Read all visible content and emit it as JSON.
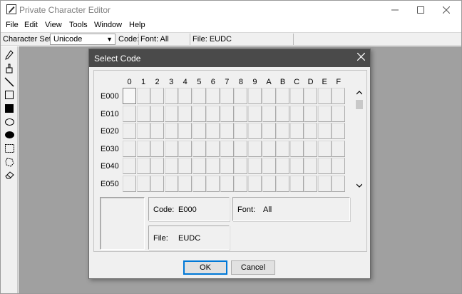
{
  "window": {
    "title": "Private Character Editor"
  },
  "menu": [
    "File",
    "Edit",
    "View",
    "Tools",
    "Window",
    "Help"
  ],
  "toolbar": {
    "charset_label": "Character Set:",
    "charset_value": "Unicode",
    "code_label": "Code:",
    "font_label": "Font: All",
    "file_label": "File: EUDC"
  },
  "tools": [
    "pencil-icon",
    "brush-icon",
    "line-icon",
    "hollow-rectangle-icon",
    "filled-rectangle-icon",
    "hollow-ellipse-icon",
    "filled-ellipse-icon",
    "rectangular-selection-icon",
    "freeform-selection-icon",
    "eraser-icon"
  ],
  "dialog": {
    "title": "Select Code",
    "columns": [
      "0",
      "1",
      "2",
      "3",
      "4",
      "5",
      "6",
      "7",
      "8",
      "9",
      "A",
      "B",
      "C",
      "D",
      "E",
      "F"
    ],
    "rows": [
      "E000",
      "E010",
      "E020",
      "E030",
      "E040",
      "E050"
    ],
    "selected_code": "E000",
    "code_label": "Code:",
    "code_value": "E000",
    "font_label": "Font:",
    "font_value": "All",
    "file_label": "File:",
    "file_value": "EUDC",
    "ok_label": "OK",
    "cancel_label": "Cancel"
  }
}
